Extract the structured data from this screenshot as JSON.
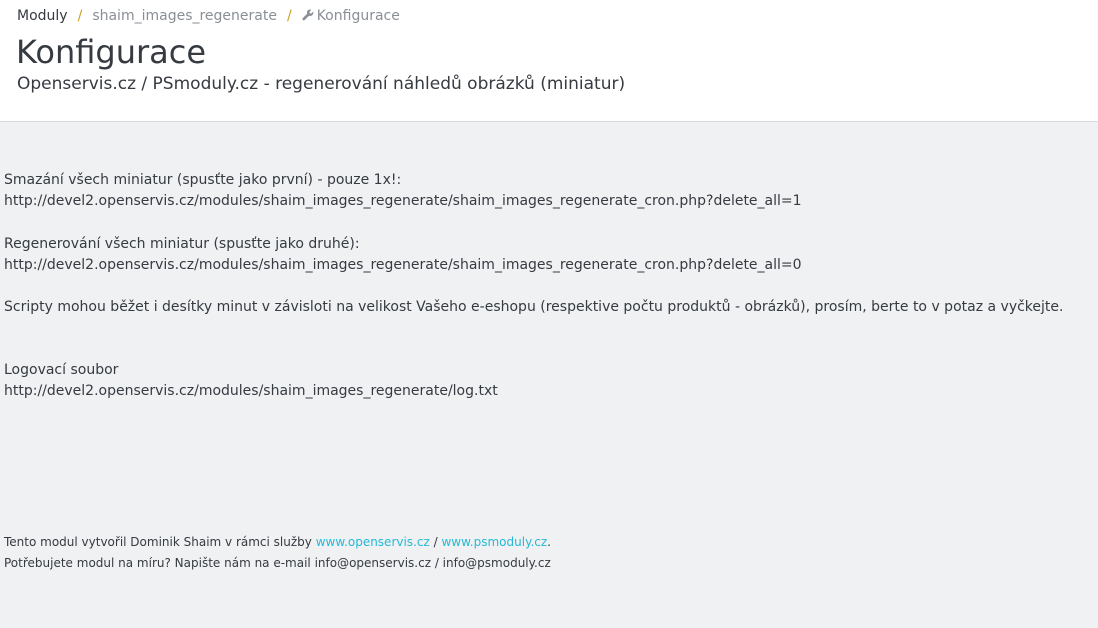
{
  "breadcrumb": {
    "root": "Moduly",
    "separator": "/",
    "module": "shaim_images_regenerate",
    "current": "Konfigurace"
  },
  "page": {
    "title": "Konfigurace",
    "subtitle": "Openservis.cz / PSmoduly.cz - regenerování náhledů obrázků (miniatur)"
  },
  "content": {
    "delete_label": "Smazání všech miniatur (spusťte jako první) - pouze 1x!:",
    "delete_url": "http://devel2.openservis.cz/modules/shaim_images_regenerate/shaim_images_regenerate_cron.php?delete_all=1",
    "regenerate_label": "Regenerování všech miniatur (spusťte jako druhé):",
    "regenerate_url": "http://devel2.openservis.cz/modules/shaim_images_regenerate/shaim_images_regenerate_cron.php?delete_all=0",
    "note": "Scripty mohou běžet i desítky minut v závisloti na velikost Vašeho e-eshopu (respektive počtu produktů - obrázků), prosím, berte to v potaz a vyčkejte.",
    "log_label": "Logovací soubor",
    "log_url": "http://devel2.openservis.cz/modules/shaim_images_regenerate/log.txt"
  },
  "footer": {
    "line1_prefix": "Tento modul vytvořil Dominik Shaim v rámci služby ",
    "link1": "www.openservis.cz",
    "line1_sep": " / ",
    "link2": "www.psmoduly.cz",
    "line1_suffix": ".",
    "line2": "Potřebujete modul na míru? Napište nám na e-mail info@openservis.cz / info@psmoduly.cz"
  },
  "colors": {
    "link": "#25b9d7",
    "separator": "#c9a227",
    "background": "#eff1f2"
  },
  "icons": {
    "current_crumb": "wrench-icon"
  }
}
